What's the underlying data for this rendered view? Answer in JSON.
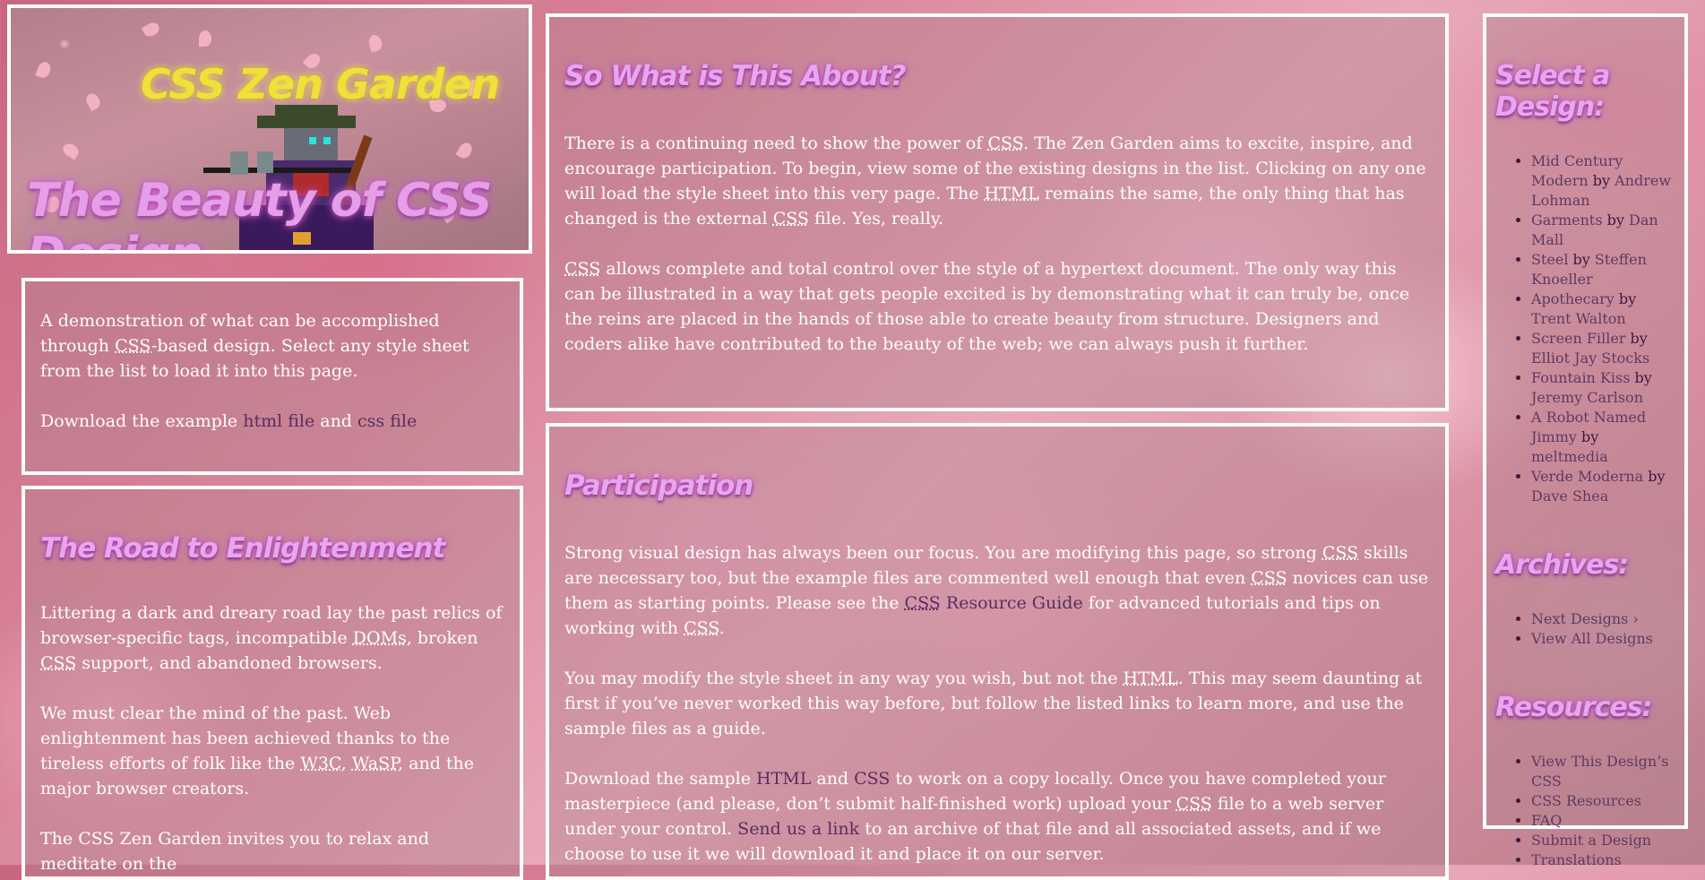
{
  "header": {
    "site_name": "CSS Zen Garden",
    "tagline": "The Beauty of CSS Design"
  },
  "intro": {
    "p1_a": "A demonstration of what can be accomplished through ",
    "p1_abbr": "CSS",
    "p1_b": "-based design. Select any style sheet from the list to load it into this page.",
    "p2_a": "Download the example ",
    "html_link": "html file",
    "p2_and": " and ",
    "css_link": "css file"
  },
  "road": {
    "title": "The Road to Enlightenment",
    "p1_a": "Littering a dark and dreary road lay the past relics of browser-specific tags, incompatible ",
    "p1_abbr1": "DOMs",
    "p1_b": ", broken ",
    "p1_abbr2": "CSS",
    "p1_c": " support, and abandoned browsers.",
    "p2_a": "We must clear the mind of the past. Web enlightenment has been achieved thanks to the tireless efforts of folk like the ",
    "p2_abbr1": "W3C",
    "p2_sep": ", ",
    "p2_abbr2": "WaSP",
    "p2_b": ", and the major browser creators.",
    "p3": "The CSS Zen Garden invites you to relax and meditate on the"
  },
  "about": {
    "title": "So What is This About?",
    "p1_a": "There is a continuing need to show the power of ",
    "p1_abbr1": "CSS",
    "p1_b": ". The Zen Garden aims to excite, inspire, and encourage participation. To begin, view some of the existing designs in the list. Clicking on any one will load the style sheet into this very page. The ",
    "p1_abbr2": "HTML",
    "p1_c": " remains the same, the only thing that has changed is the external ",
    "p1_abbr3": "CSS",
    "p1_d": " file. Yes, really.",
    "p2_abbr": "CSS",
    "p2": " allows complete and total control over the style of a hypertext document. The only way this can be illustrated in a way that gets people excited is by demonstrating what it can truly be, once the reins are placed in the hands of those able to create beauty from structure. Designers and coders alike have contributed to the beauty of the web; we can always push it further."
  },
  "participation": {
    "title": "Participation",
    "p1_a": "Strong visual design has always been our focus. You are modifying this page, so strong ",
    "p1_abbr1": "CSS",
    "p1_b": " skills are necessary too, but the example files are commented well enough that even ",
    "p1_abbr2": "CSS",
    "p1_c": " novices can use them as starting points. Please see the ",
    "p1_link_abbr": "CSS",
    "p1_link": " Resource Guide",
    "p1_d": " for advanced tutorials and tips on working with ",
    "p1_abbr3": "CSS",
    "p1_e": ".",
    "p2_a": "You may modify the style sheet in any way you wish, but not the ",
    "p2_abbr": "HTML",
    "p2_b": ". This may seem daunting at first if you’ve never worked this way before, but follow the listed links to learn more, and use the sample files as a guide.",
    "p3_a": "Download the sample ",
    "p3_link1": "HTML",
    "p3_and": " and ",
    "p3_link2": "CSS",
    "p3_b": " to work on a copy locally. Once you have completed your masterpiece (and please, don’t submit half-finished work) upload your ",
    "p3_abbr": "CSS",
    "p3_c": " file to a web server under your control. ",
    "p3_link3": "Send us a link",
    "p3_d": " to an archive of that file and all associated assets, and if we choose to use it we will download it and place it on our server."
  },
  "sidebar": {
    "select_title": "Select a Design:",
    "designs": [
      {
        "name": "Mid Century Modern",
        "by": " by ",
        "author": "Andrew Lohman"
      },
      {
        "name": "Garments",
        "by": " by ",
        "author": "Dan Mall"
      },
      {
        "name": "Steel",
        "by": " by ",
        "author": "Steffen Knoeller"
      },
      {
        "name": "Apothecary",
        "by": " by ",
        "author": "Trent Walton"
      },
      {
        "name": "Screen Filler",
        "by": " by ",
        "author": "Elliot Jay Stocks"
      },
      {
        "name": "Fountain Kiss",
        "by": " by ",
        "author": "Jeremy Carlson"
      },
      {
        "name": "A Robot Named Jimmy",
        "by": " by ",
        "author": "meltmedia"
      },
      {
        "name": "Verde Moderna",
        "by": " by ",
        "author": "Dave Shea"
      }
    ],
    "archives_title": "Archives:",
    "archives": [
      "Next Designs ›",
      "View All Designs"
    ],
    "resources_title": "Resources:",
    "resources": [
      "View This Design’s CSS",
      "CSS Resources",
      "FAQ",
      "Submit a Design",
      "Translations"
    ]
  },
  "colors": {
    "heading": "#e7a6ee",
    "site_name": "#f0e03a",
    "link": "#5a2d5f",
    "panel_border": "#ffffff"
  }
}
